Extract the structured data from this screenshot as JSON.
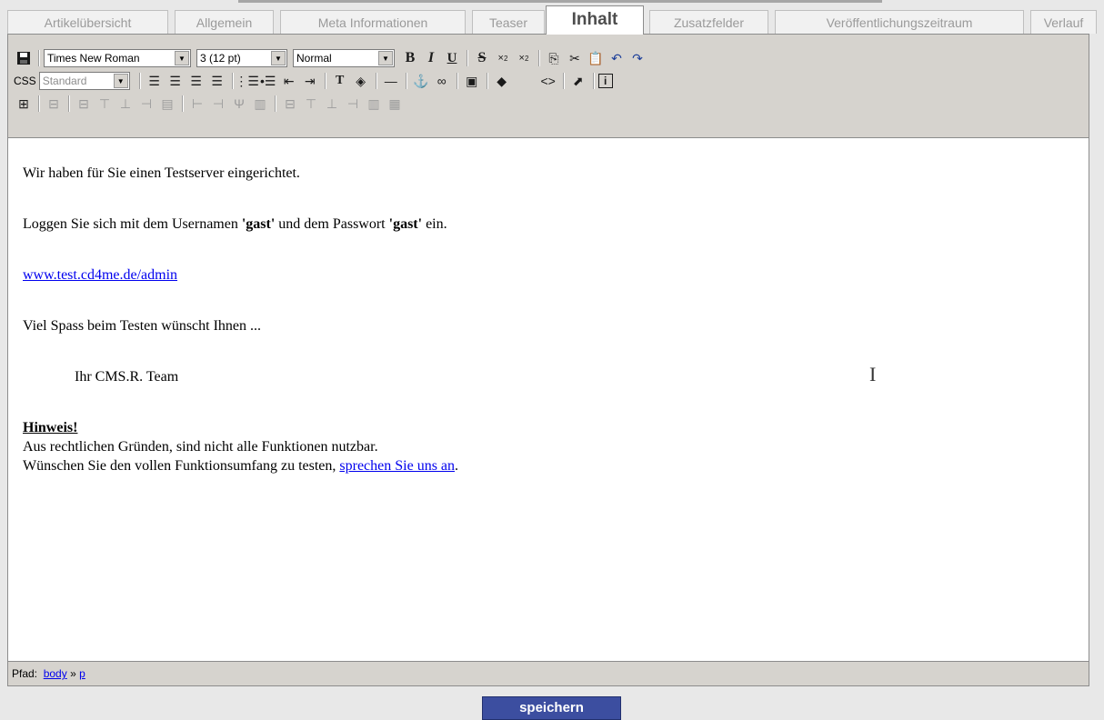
{
  "tabs": [
    {
      "label": "Artikelübersicht"
    },
    {
      "label": "Allgemein"
    },
    {
      "label": "Meta Informationen"
    },
    {
      "label": "Teaser"
    },
    {
      "label": "Inhalt"
    },
    {
      "label": "Zusatzfelder"
    },
    {
      "label": "Veröffentlichungszeitraum"
    },
    {
      "label": "Verlauf"
    }
  ],
  "active_tab": "Inhalt",
  "toolbar": {
    "font_family": "Times New Roman",
    "font_size": "3 (12 pt)",
    "format": "Normal",
    "css_label": "CSS",
    "css_class": "Standard"
  },
  "content": {
    "line1": "Wir haben für Sie einen Testserver eingerichtet.",
    "line2_a": "Loggen Sie sich mit dem Usernamen ",
    "line2_b": "'gast'",
    "line2_c": " und dem Passwort ",
    "line2_d": "'gast'",
    "line2_e": " ein.",
    "link": "www.test.cd4me.de/admin",
    "line4": "Viel Spass beim Testen wünscht Ihnen ...",
    "line5": "Ihr CMS.R. Team",
    "hint_title": "Hinweis!",
    "hint_line1": "Aus rechtlichen Gründen, sind nicht alle Funktionen nutzbar.",
    "hint_line2": "Wünschen Sie den vollen Funktionsumfang zu testen, ",
    "hint_link": "sprechen Sie uns an",
    "hint_end": "."
  },
  "statusbar": {
    "path_label": "Pfad:",
    "path_body": "body",
    "path_sep": "»",
    "path_p": "p"
  },
  "save_button": "speichern",
  "colors": {
    "toolbar_bg": "#d6d3ce",
    "button_bg": "#3c4ea0",
    "link": "#0000ee"
  }
}
